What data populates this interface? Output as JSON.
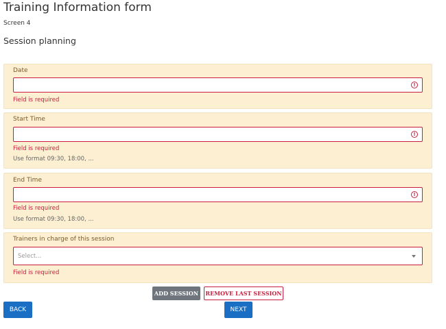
{
  "header": {
    "title": "Training Information form",
    "screen": "Screen 4",
    "section": "Session planning"
  },
  "fields": {
    "date": {
      "label": "Date",
      "value": "",
      "error": "Field is required"
    },
    "start_time": {
      "label": "Start Time",
      "value": "",
      "error": "Field is required",
      "hint": "Use format 09:30, 18:00, ..."
    },
    "end_time": {
      "label": "End Time",
      "value": "",
      "error": "Field is required",
      "hint": "Use format 09:30, 18:00, ..."
    },
    "trainers": {
      "label": "Trainers in charge of this session",
      "placeholder": "Select...",
      "error": "Field is required"
    }
  },
  "actions": {
    "add_session": "ADD SESSION",
    "remove_last_session": "REMOVE LAST SESSION",
    "back": "BACK",
    "next": "NEXT"
  },
  "icons": {
    "field_error": "alert-circle-icon",
    "select_caret": "chevron-down-icon"
  },
  "colors": {
    "group_background": "#fcefd2",
    "error": "#c81e3c",
    "primary_button": "#1a6fc4",
    "secondary_button": "#6e757c"
  }
}
